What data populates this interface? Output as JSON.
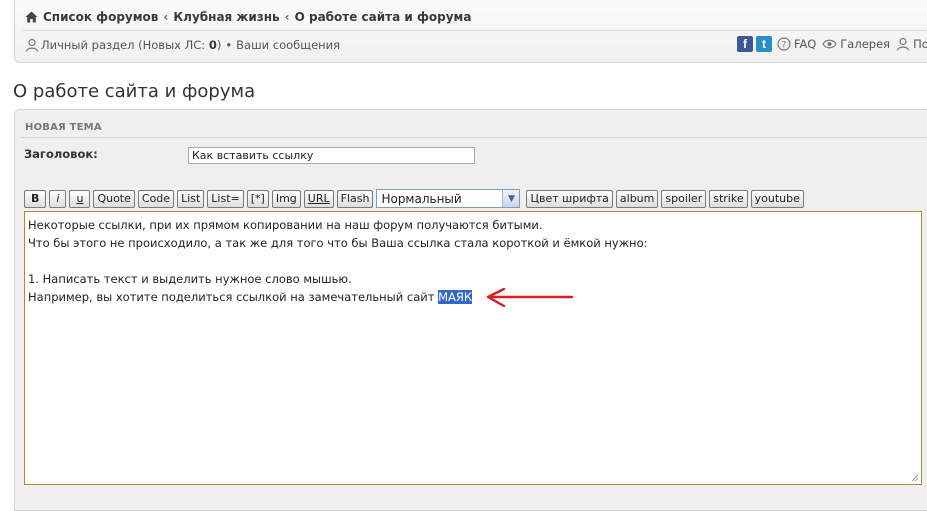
{
  "breadcrumb": {
    "items": [
      "Список форумов",
      "Клубная жизнь",
      "О работе сайта и форума"
    ],
    "sep": "‹"
  },
  "user_bar": {
    "personal": "Личный раздел (Новых ЛС: ",
    "new_pm": "0",
    "personal_end": ")",
    "bullet": "•",
    "my_posts": "Ваши сообщения"
  },
  "links": {
    "facebook": "f",
    "twitter": "t",
    "faq": "FAQ",
    "gallery": "Галерея",
    "users": "По"
  },
  "page_title": "О работе сайта и форума",
  "panel": {
    "heading": "НОВАЯ ТЕМА",
    "subject_label": "Заголовок:",
    "subject_value": "Как вставить ссылку"
  },
  "toolbar": {
    "b": "B",
    "i": "i",
    "u": "u",
    "quote": "Quote",
    "code": "Code",
    "list": "List",
    "list_eq": "List=",
    "star": "[*]",
    "img": "Img",
    "url": "URL",
    "flash": "Flash",
    "font_size": "Нормальный",
    "font_color": "Цвет шрифта",
    "album": "album",
    "spoiler": "spoiler",
    "strike": "strike",
    "youtube": "youtube"
  },
  "editor": {
    "line1": "Некоторые ссылки, при их прямом копировании на наш форум получаются битыми.",
    "line2": "Что бы этого не происходило, а так же для того что бы Ваша ссылка стала короткой и ёмкой нужно:",
    "line3": "1. Написать текст и выделить нужное слово мышью.",
    "line4": "Например,  вы хотите поделиться ссылкой на замечательный сайт ",
    "selected_word": "МАЯК"
  },
  "colors": {
    "arrow": "#d81f1f",
    "selection": "#3269c6",
    "editor_border": "#b08a2c"
  }
}
